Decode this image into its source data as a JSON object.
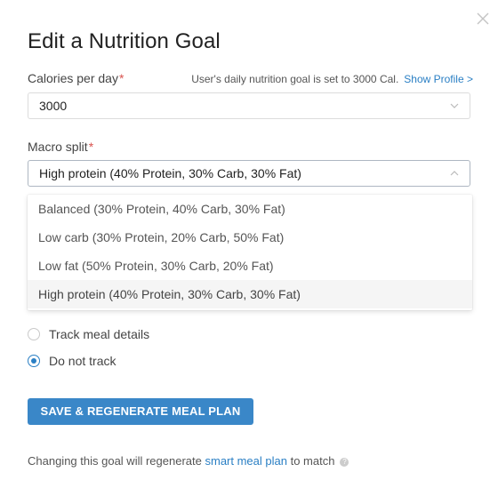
{
  "dialog": {
    "title": "Edit a Nutrition Goal",
    "close_icon": "close-icon"
  },
  "calories": {
    "label": "Calories per day",
    "required_mark": "*",
    "hint": "User's daily nutrition goal is set to 3000 Cal.",
    "show_profile_link": "Show Profile >",
    "value": "3000"
  },
  "macro": {
    "label": "Macro split",
    "required_mark": "*",
    "value": "High protein (40% Protein, 30% Carb, 30% Fat)",
    "options": [
      "Balanced (30% Protein, 40% Carb, 30% Fat)",
      "Low carb (30% Protein, 20% Carb, 50% Fat)",
      "Low fat (50% Protein, 30% Carb, 20% Fat)",
      "High protein (40% Protein, 30% Carb, 30% Fat)"
    ],
    "selected_index": 3
  },
  "tracking": {
    "options": [
      "Track meal details",
      "Do not track"
    ],
    "selected_index": 1
  },
  "save_button": "SAVE & REGENERATE MEAL PLAN",
  "footer": {
    "text_before": "Changing this goal will regenerate",
    "link": "smart meal plan",
    "text_after": "to match",
    "help_icon": "question-icon",
    "help_glyph": "?"
  },
  "colors": {
    "accent": "#3a87c8",
    "link": "#2a7fc4",
    "required": "#d9534f"
  }
}
